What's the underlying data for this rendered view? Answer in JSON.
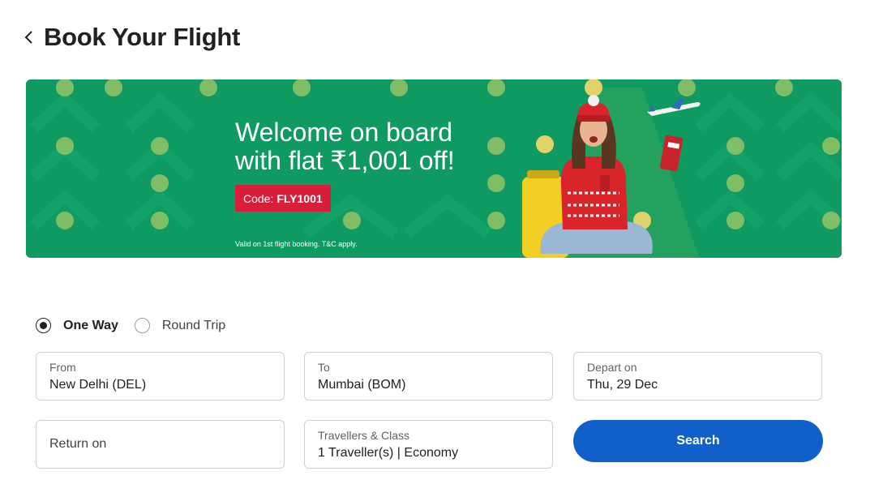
{
  "header": {
    "title": "Book Your Flight",
    "back_icon": "chevron-left-icon"
  },
  "banner": {
    "headline_line1": "Welcome on board",
    "headline_line2": "with flat ₹1,001 off!",
    "code_label": "Code:",
    "code_value": "FLY1001",
    "fine_print": "Valid on 1st flight booking. T&C apply.",
    "colors": {
      "background": "#0f9a61",
      "badge": "#d81e3a"
    }
  },
  "trip_type": {
    "options": [
      {
        "label": "One Way",
        "selected": true
      },
      {
        "label": "Round Trip",
        "selected": false
      }
    ]
  },
  "form": {
    "from": {
      "label": "From",
      "value": "New Delhi (DEL)"
    },
    "to": {
      "label": "To",
      "value": "Mumbai (BOM)"
    },
    "depart": {
      "label": "Depart on",
      "value": "Thu, 29 Dec"
    },
    "return": {
      "placeholder": "Return on"
    },
    "travellers": {
      "label": "Travellers & Class",
      "value": "1 Traveller(s) | Economy"
    },
    "search_label": "Search"
  },
  "colors": {
    "primary": "#1160c9"
  }
}
